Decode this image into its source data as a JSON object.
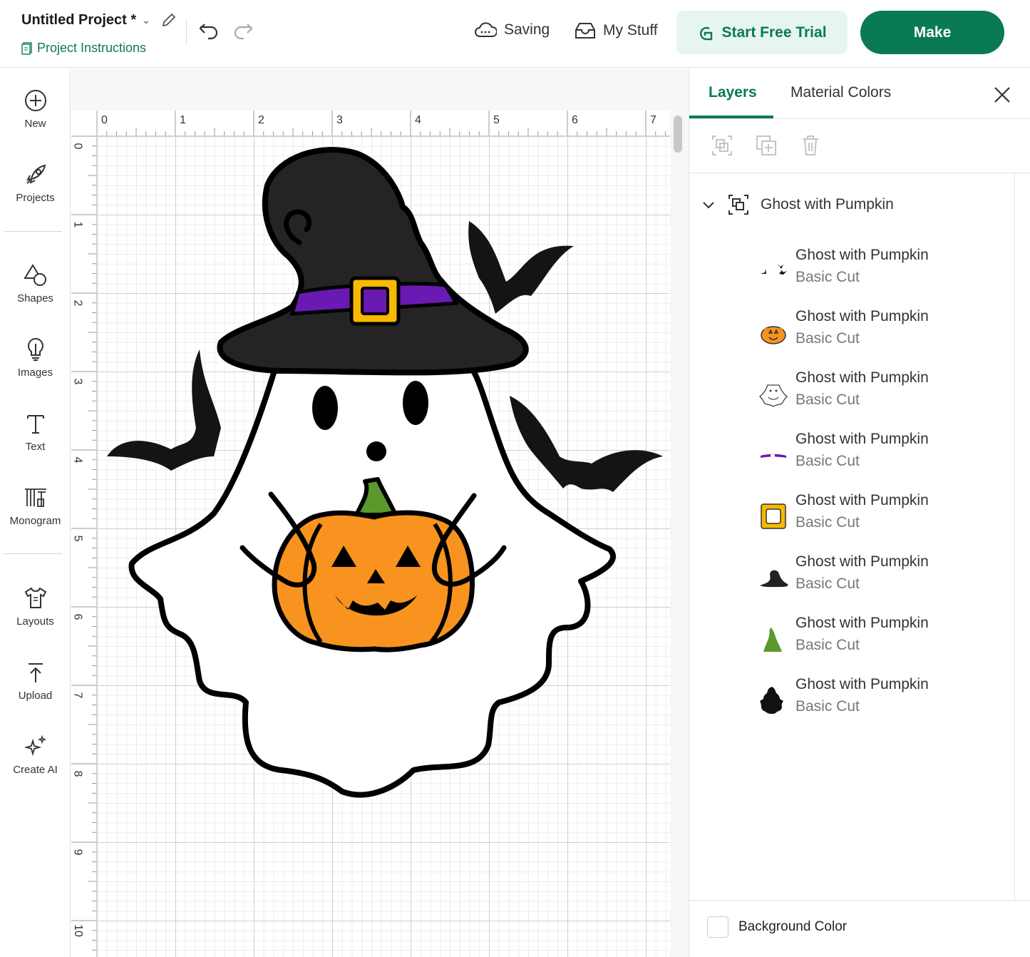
{
  "header": {
    "project_title": "Untitled Project *",
    "project_instructions": "Project Instructions",
    "saving": "Saving",
    "my_stuff": "My Stuff",
    "trial_label": "Start Free Trial",
    "make_label": "Make",
    "accent": "#0a7a53"
  },
  "sidebar": {
    "items": [
      {
        "label": "New",
        "icon": "plus-circle-icon"
      },
      {
        "label": "Projects",
        "icon": "rocket-icon"
      },
      {
        "label": "Shapes",
        "icon": "shapes-icon"
      },
      {
        "label": "Images",
        "icon": "bulb-icon"
      },
      {
        "label": "Text",
        "icon": "text-icon"
      },
      {
        "label": "Monogram",
        "icon": "monogram-icon"
      },
      {
        "label": "Layouts",
        "icon": "shirt-icon"
      },
      {
        "label": "Upload",
        "icon": "upload-icon"
      },
      {
        "label": "Create AI",
        "icon": "sparkle-icon"
      }
    ]
  },
  "canvas": {
    "ruler_top": [
      "0",
      "1",
      "2",
      "3",
      "4",
      "5",
      "6",
      "7"
    ],
    "ruler_left": [
      "0",
      "1",
      "2",
      "3",
      "4",
      "5",
      "6",
      "7",
      "8",
      "9",
      "10"
    ]
  },
  "panel": {
    "tabs": [
      "Layers",
      "Material Colors"
    ],
    "group_name": "Ghost with Pumpkin",
    "layers": [
      {
        "name": "Ghost with Pumpkin",
        "type": "Basic Cut",
        "thumb": "bats"
      },
      {
        "name": "Ghost with Pumpkin",
        "type": "Basic Cut",
        "thumb": "pumpkin"
      },
      {
        "name": "Ghost with Pumpkin",
        "type": "Basic Cut",
        "thumb": "ghost"
      },
      {
        "name": "Ghost with Pumpkin",
        "type": "Basic Cut",
        "thumb": "band"
      },
      {
        "name": "Ghost with Pumpkin",
        "type": "Basic Cut",
        "thumb": "buckle"
      },
      {
        "name": "Ghost with Pumpkin",
        "type": "Basic Cut",
        "thumb": "hat"
      },
      {
        "name": "Ghost with Pumpkin",
        "type": "Basic Cut",
        "thumb": "stem"
      },
      {
        "name": "Ghost with Pumpkin",
        "type": "Basic Cut",
        "thumb": "outline"
      }
    ],
    "background_color_label": "Background Color"
  }
}
